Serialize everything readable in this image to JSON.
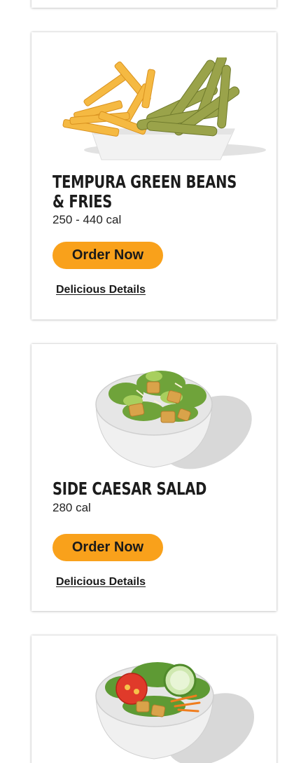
{
  "menu_items": [
    {
      "title": "Tempura Green Beans & Fries",
      "calories": "250 - 440 cal",
      "order_label": "Order Now",
      "details_label": "Delicious Details",
      "image": "tempura-green-beans-fries-image"
    },
    {
      "title": "Side Caesar Salad",
      "calories": "280 cal",
      "order_label": "Order Now",
      "details_label": "Delicious Details",
      "image": "side-caesar-salad-image"
    },
    {
      "image": "side-garden-salad-image"
    }
  ],
  "colors": {
    "button": "#f9a11b",
    "text": "#1c1c1c",
    "card_background": "#ffffff"
  }
}
